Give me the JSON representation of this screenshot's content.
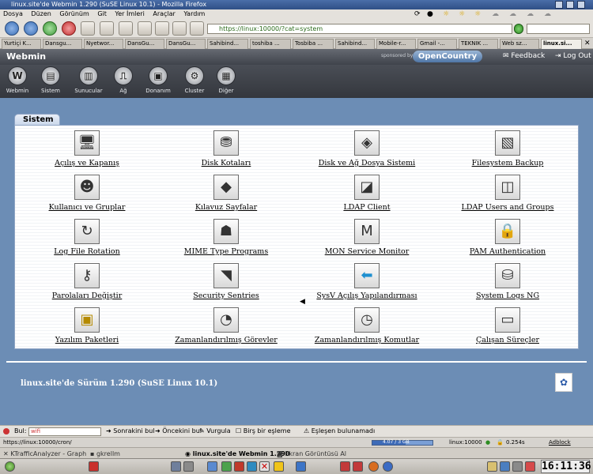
{
  "window": {
    "title": "linux.site'de Webmin 1.290 (SuSE Linux 10.1) - Mozilla Firefox"
  },
  "menu": [
    "Dosya",
    "Düzen",
    "Görünüm",
    "Git",
    "Yer İmleri",
    "Araçlar",
    "Yardım"
  ],
  "address": {
    "url": "https://linux:10000/?cat=system"
  },
  "tabs": [
    "Yurtiçi K...",
    "Dansgu...",
    "Nyetwor...",
    "DansGu...",
    "DansGu...",
    "Sahibind...",
    "toshiba ...",
    "Tosbiba ...",
    "Sahibind...",
    "Mobile-r...",
    "Gmail -...",
    "TEKNIK ...",
    "Web sz...",
    "linux.si..."
  ],
  "webmin_header": {
    "logo": "Webmin",
    "sponsored": "sponsored by",
    "sponsor": "OpenCountry",
    "feedback": "Feedback",
    "logout": "Log Out"
  },
  "categories": [
    {
      "label": "Webmin",
      "icon": "webmin-icon"
    },
    {
      "label": "Sistem",
      "icon": "system-icon"
    },
    {
      "label": "Sunucular",
      "icon": "servers-icon"
    },
    {
      "label": "Ağ",
      "icon": "network-icon"
    },
    {
      "label": "Donanım",
      "icon": "hardware-icon"
    },
    {
      "label": "Cluster",
      "icon": "cluster-icon"
    },
    {
      "label": "Diğer",
      "icon": "others-icon"
    }
  ],
  "section": {
    "title": "Sistem"
  },
  "modules": [
    {
      "label": "Açılış ve Kapanış",
      "icon": "monitor-icon"
    },
    {
      "label": "Disk Kotaları",
      "icon": "disk-quota-icon"
    },
    {
      "label": "Disk ve Ağ Dosya Sistemi",
      "icon": "filesystems-icon"
    },
    {
      "label": "Filesystem Backup",
      "icon": "backup-icon"
    },
    {
      "label": "Kullanıcı ve Gruplar",
      "icon": "users-icon"
    },
    {
      "label": "Kılavuz Sayfalar",
      "icon": "manual-book-icon"
    },
    {
      "label": "LDAP Client",
      "icon": "ldap-client-icon"
    },
    {
      "label": "LDAP Users and Groups",
      "icon": "ldap-users-icon"
    },
    {
      "label": "Log File Rotation",
      "icon": "log-rotation-icon"
    },
    {
      "label": "MIME Type Programs",
      "icon": "mime-icon"
    },
    {
      "label": "MON Service Monitor",
      "icon": "mon-icon"
    },
    {
      "label": "PAM Authentication",
      "icon": "padlock-icon"
    },
    {
      "label": "Parolaları Değiştir",
      "icon": "keys-icon"
    },
    {
      "label": "Security Sentries",
      "icon": "security-icon"
    },
    {
      "label": "SysV Açılış Yapılandırması",
      "icon": "sysv-arrow-icon"
    },
    {
      "label": "System Logs NG",
      "icon": "syslog-icon"
    },
    {
      "label": "Yazılım Paketleri",
      "icon": "package-icon"
    },
    {
      "label": "Zamanlandırılmış Görevler",
      "icon": "cron-icon"
    },
    {
      "label": "Zamanlandırılmış Komutlar",
      "icon": "clock-icon"
    },
    {
      "label": "Çalışan Süreçler",
      "icon": "processes-icon"
    }
  ],
  "footer": {
    "version_text": "linux.site'de Sürüm 1.290 (SuSE Linux 10.1)"
  },
  "findbar": {
    "label": "Bul:",
    "query": "wifi",
    "next": "Sonrakini bul",
    "prev": "Öncekini bul",
    "highlight": "Vurgula",
    "match_case": "Birş bir eşleme",
    "result": "Eşleşen bulunamadı"
  },
  "statusbar": {
    "url": "https://linux:10000/cron/",
    "disk": "4.07 / 3 GB",
    "disk_fill_fraction": 0.55,
    "host": "linux:10000",
    "time": "0.254s",
    "adblock": "Adblock"
  },
  "taskbar": {
    "items": [
      "KTrafficAnalyzer - Graph",
      "gkrellm",
      "linux.site'de Webmin 1.290",
      "Ekran Görüntüsü Al"
    ]
  },
  "clock": {
    "time": "16:11:36"
  },
  "colors": {
    "page_bg": "#6c8db5",
    "header_bg": "#3f434b",
    "link": "#000000"
  }
}
